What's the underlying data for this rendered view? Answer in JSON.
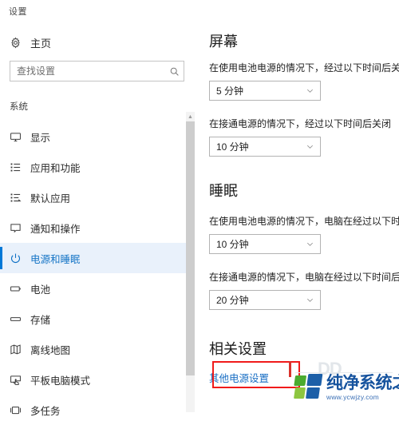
{
  "app": {
    "title": "设置"
  },
  "sidebar": {
    "home": {
      "label": "主页",
      "icon": "gear-icon"
    },
    "search": {
      "value": "",
      "placeholder": "查找设置",
      "icon": "search-icon"
    },
    "section_label": "系统",
    "accent_color": "#0078d7",
    "items": [
      {
        "label": "显示",
        "icon": "monitor-icon",
        "selected": false
      },
      {
        "label": "应用和功能",
        "icon": "app-list-icon",
        "selected": false
      },
      {
        "label": "默认应用",
        "icon": "default-apps-icon",
        "selected": false
      },
      {
        "label": "通知和操作",
        "icon": "notification-icon",
        "selected": false
      },
      {
        "label": "电源和睡眠",
        "icon": "power-icon",
        "selected": true
      },
      {
        "label": "电池",
        "icon": "battery-icon",
        "selected": false
      },
      {
        "label": "存储",
        "icon": "storage-icon",
        "selected": false
      },
      {
        "label": "离线地图",
        "icon": "map-icon",
        "selected": false
      },
      {
        "label": "平板电脑模式",
        "icon": "tablet-mode-icon",
        "selected": false
      },
      {
        "label": "多任务",
        "icon": "multitasking-icon",
        "selected": false
      }
    ],
    "scrollbar": {
      "up_arrow": "▲"
    }
  },
  "main": {
    "screen": {
      "title": "屏幕",
      "battery_desc": "在使用电池电源的情况下，经过以下时间后关闭",
      "battery_value": "5 分钟",
      "plugged_desc": "在接通电源的情况下，经过以下时间后关闭",
      "plugged_value": "10 分钟"
    },
    "sleep": {
      "title": "睡眠",
      "battery_desc": "在使用电池电源的情况下，电脑在经过以下时间后进入睡眠状态",
      "battery_value": "10 分钟",
      "plugged_desc": "在接通电源的情况下，电脑在经过以下时间后进入睡眠状态",
      "plugged_value": "20 分钟"
    },
    "related": {
      "title": "相关设置",
      "link_label": "其他电源设置",
      "link_color": "#1a6fc4",
      "highlight_color": "#f01b1b"
    },
    "combo_arrow": "⌄"
  },
  "watermark": {
    "name": "纯净系统之家",
    "url": "www.ycwjzy.com",
    "ghost": "DD"
  }
}
